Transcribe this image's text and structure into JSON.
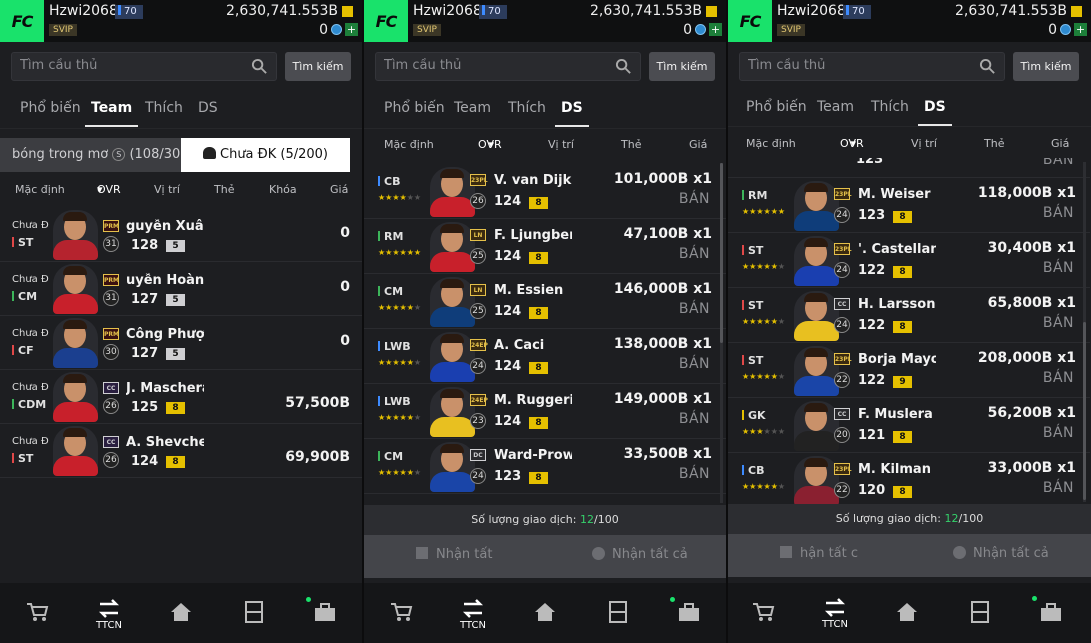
{
  "header": {
    "username": "Hzwi2068",
    "level": "70",
    "badge": "SVIP",
    "bp": "2,630,741.553B",
    "coins": "0"
  },
  "search": {
    "placeholder": "Tìm cầu thủ",
    "button": "Tìm kiếm"
  },
  "tabs": [
    "Phổ biến",
    "Team",
    "Thích",
    "DS"
  ],
  "colors": {
    "accent": "#19e26b",
    "level_badge": "#e5c000",
    "level_badge_pink": "#cfcfd2",
    "trade_count": "#35d06b"
  },
  "panel1": {
    "active_tab": "Team",
    "segments": {
      "left": "bóng trong mơ",
      "left_count": "(108/300)",
      "right": "Chưa ĐK (5/200)"
    },
    "columns": [
      "Mặc định",
      "OVR",
      "Vị trí",
      "Thẻ",
      "Khóa",
      "Giá"
    ],
    "players": [
      {
        "status": "Chưa Đ",
        "pos": "ST",
        "pos_color": "#e04848",
        "card": "PRM",
        "rank": "31",
        "name": "guyễn Xuân S",
        "ovr": "128",
        "level": "5",
        "price": "0"
      },
      {
        "status": "Chưa Đ",
        "pos": "CM",
        "pos_color": "#3cb55a",
        "card": "PRM",
        "rank": "31",
        "name": "uyễn Hoàng Đ",
        "ovr": "127",
        "level": "5",
        "price": "0"
      },
      {
        "status": "Chưa Đ",
        "pos": "CF",
        "pos_color": "#e04848",
        "card": "PRM",
        "rank": "30",
        "name": "Công Phượng",
        "ovr": "127",
        "level": "5",
        "price": "0"
      },
      {
        "status": "Chưa Đ",
        "pos": "CDM",
        "pos_color": "#3cb55a",
        "card": "CC",
        "rank": "26",
        "name": "J. Mascheran",
        "ovr": "125",
        "level": "8",
        "price": "57,500B"
      },
      {
        "status": "Chưa Đ",
        "pos": "ST",
        "pos_color": "#e04848",
        "card": "CC",
        "rank": "26",
        "name": "A. Shevchenk",
        "ovr": "124",
        "level": "8",
        "price": "69,900B"
      }
    ]
  },
  "panel2": {
    "active_tab": "DS",
    "columns": [
      "Mặc định",
      "OVR",
      "Vị trí",
      "Thẻ",
      "Giá"
    ],
    "players": [
      {
        "pos": "CB",
        "pos_color": "#3d8bff",
        "stars": 4,
        "card": "23PL",
        "rank": "26",
        "name": "V. van Dijk",
        "ovr": "124",
        "level": "8",
        "price": "101,000B x1",
        "sell": "BÁN"
      },
      {
        "pos": "RM",
        "pos_color": "#3cb55a",
        "stars": 6,
        "card": "LN",
        "rank": "25",
        "name": "F. Ljungberg",
        "ovr": "124",
        "level": "8",
        "price": "47,100B x1",
        "sell": "BÁN"
      },
      {
        "pos": "CM",
        "pos_color": "#3cb55a",
        "stars": 5,
        "card": "LN",
        "rank": "25",
        "name": "M. Essien",
        "ovr": "124",
        "level": "8",
        "price": "146,000B x1",
        "sell": "BÁN"
      },
      {
        "pos": "LWB",
        "pos_color": "#3d8bff",
        "stars": 5,
        "card": "24EP",
        "rank": "24",
        "name": "A. Caci",
        "ovr": "124",
        "level": "8",
        "price": "138,000B x1",
        "sell": "BÁN"
      },
      {
        "pos": "LWB",
        "pos_color": "#3d8bff",
        "stars": 5,
        "card": "24EP",
        "rank": "23",
        "name": "M. Ruggeri",
        "ovr": "124",
        "level": "8",
        "price": "149,000B x1",
        "sell": "BÁN"
      },
      {
        "pos": "CM",
        "pos_color": "#3cb55a",
        "stars": 5,
        "card": "DC",
        "rank": "24",
        "name": "Ward-Prows",
        "ovr": "123",
        "level": "8",
        "price": "33,500B x1",
        "sell": "BÁN"
      }
    ],
    "trade_label": "Số lượng giao dịch:",
    "trade_used": "12",
    "trade_total": "/100",
    "claim_left": "Nhận tất",
    "claim_right": "Nhận tất cả",
    "nav_label": "TTCN"
  },
  "panel3": {
    "active_tab": "DS",
    "columns": [
      "Mặc định",
      "OVR",
      "Vị trí",
      "Thẻ",
      "Giá"
    ],
    "partial": {
      "ovr": "123",
      "price": "BÁN"
    },
    "players": [
      {
        "pos": "RM",
        "pos_color": "#3cb55a",
        "stars": 6,
        "card": "23PL",
        "rank": "24",
        "name": "M. Weiser",
        "ovr": "123",
        "level": "8",
        "price": "118,000B x1",
        "sell": "BÁN"
      },
      {
        "pos": "ST",
        "pos_color": "#e04848",
        "stars": 5,
        "card": "23PL",
        "rank": "24",
        "name": "'. Castellanos",
        "ovr": "122",
        "level": "8",
        "price": "30,400B x1",
        "sell": "BÁN"
      },
      {
        "pos": "ST",
        "pos_color": "#e04848",
        "stars": 5,
        "card": "CC",
        "rank": "24",
        "name": "H. Larsson",
        "ovr": "122",
        "level": "8",
        "price": "65,800B x1",
        "sell": "BÁN"
      },
      {
        "pos": "ST",
        "pos_color": "#e04848",
        "stars": 5,
        "card": "23PL",
        "rank": "22",
        "name": "Borja Mayora",
        "ovr": "122",
        "level": "9",
        "price": "208,000B x1",
        "sell": "BÁN"
      },
      {
        "pos": "GK",
        "pos_color": "#e5c000",
        "stars": 3,
        "card": "CC",
        "rank": "20",
        "name": "F. Muslera",
        "ovr": "121",
        "level": "8",
        "price": "56,200B x1",
        "sell": "BÁN"
      },
      {
        "pos": "CB",
        "pos_color": "#3d8bff",
        "stars": 5,
        "card": "23PL",
        "rank": "22",
        "name": "M. Kilman",
        "ovr": "120",
        "level": "8",
        "price": "33,000B x1",
        "sell": "BÁN"
      }
    ],
    "trade_label": "Số lượng giao dịch:",
    "trade_used": "12",
    "trade_total": "/100",
    "claim_left": "hận tất c",
    "claim_right": "Nhận tất cả",
    "nav_label": "TTCN"
  }
}
